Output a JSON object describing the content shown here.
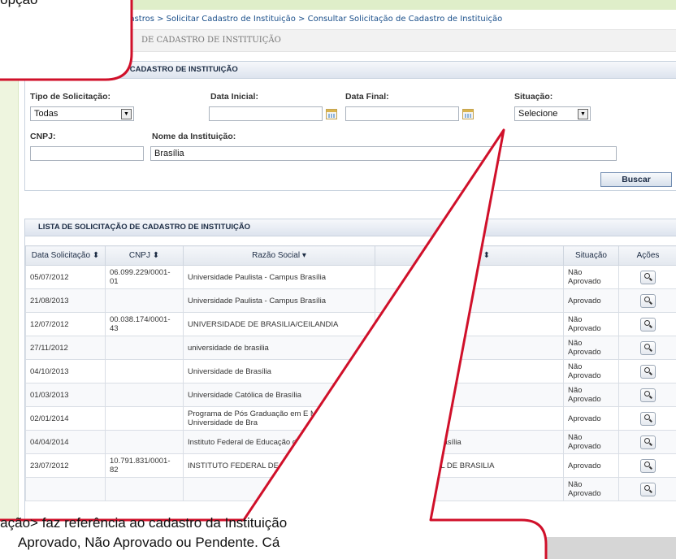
{
  "breadcrumb": "Cadastros > Solicitar Cadastro de Instituição > Consultar Solicitação de Cadastro de Instituição",
  "page_title": "DE CADASTRO DE INSTITUIÇÃO",
  "filter": {
    "panel_title": "ÃO DE CADASTRO DE INSTITUIÇÃO",
    "tipo_label": "Tipo de Solicitação:",
    "tipo_value": "Todas",
    "data_inicial_label": "Data Inicial:",
    "data_inicial_value": "",
    "data_final_label": "Data Final:",
    "data_final_value": "",
    "situacao_label": "Situação:",
    "situacao_value": "Selecione",
    "cnpj_label": "CNPJ:",
    "cnpj_value": "",
    "nome_label": "Nome da Instituição:",
    "nome_value": "Brasília",
    "search_button": "Buscar"
  },
  "list": {
    "panel_title": "LISTA DE SOLICITAÇÃO DE CADASTRO DE INSTITUIÇÃO",
    "columns": [
      "Data Solicitação ⬍",
      "CNPJ ⬍",
      "Razão Social ▾",
      "sia ⬍",
      "Situação",
      "Ações"
    ],
    "rows": [
      {
        "data": "05/07/2012",
        "cnpj": "06.099.229/0001-01",
        "razao": "Universidade Paulista - Campus Brasília",
        "fantasia": "",
        "situacao": "Não Aprovado"
      },
      {
        "data": "21/08/2013",
        "cnpj": "",
        "razao": "Universidade Paulista - Campus Brasília",
        "fantasia": "",
        "situacao": "Aprovado"
      },
      {
        "data": "12/07/2012",
        "cnpj": "00.038.174/0001-43",
        "razao": "UNIVERSIDADE DE BRASILIA/CEILANDIA",
        "fantasia": "",
        "situacao": "Não Aprovado"
      },
      {
        "data": "27/11/2012",
        "cnpj": "",
        "razao": "universidade de brasilia",
        "fantasia": "",
        "situacao": "Não Aprovado"
      },
      {
        "data": "04/10/2013",
        "cnpj": "",
        "razao": "Universidade de Brasília",
        "fantasia": "",
        "situacao": "Não Aprovado"
      },
      {
        "data": "01/03/2013",
        "cnpj": "",
        "razao": "Universidade Católica de Brasília",
        "fantasia": "",
        "situacao": "Não Aprovado"
      },
      {
        "data": "02/01/2014",
        "cnpj": "",
        "razao": "Programa de Pós Graduação em E Mestrado - Universidade de Bra",
        "fantasia": "",
        "situacao": "Aprovado"
      },
      {
        "data": "04/04/2014",
        "cnpj": "",
        "razao": "Instituto Federal de Educação de Brasília",
        "fantasia": "Brasília",
        "situacao": "Não Aprovado"
      },
      {
        "data": "23/07/2012",
        "cnpj": "10.791.831/0001-82",
        "razao": "INSTITUTO FEDERAL DE TECNOLOGIA DE BRA",
        "fantasia": "AL DE BRASILIA",
        "situacao": "Aprovado"
      },
      {
        "data": "",
        "cnpj": "",
        "razao": "",
        "fantasia": "",
        "situacao": "Não Aprovado"
      }
    ]
  },
  "callout": {
    "top_text": "a opção",
    "bottom_line1": "tuação> faz referência ao cadastro da Instituição",
    "bottom_line2": "Aprovado, Não Aprovado ou Pendente. Cá",
    "border_color": "#d0102a"
  }
}
